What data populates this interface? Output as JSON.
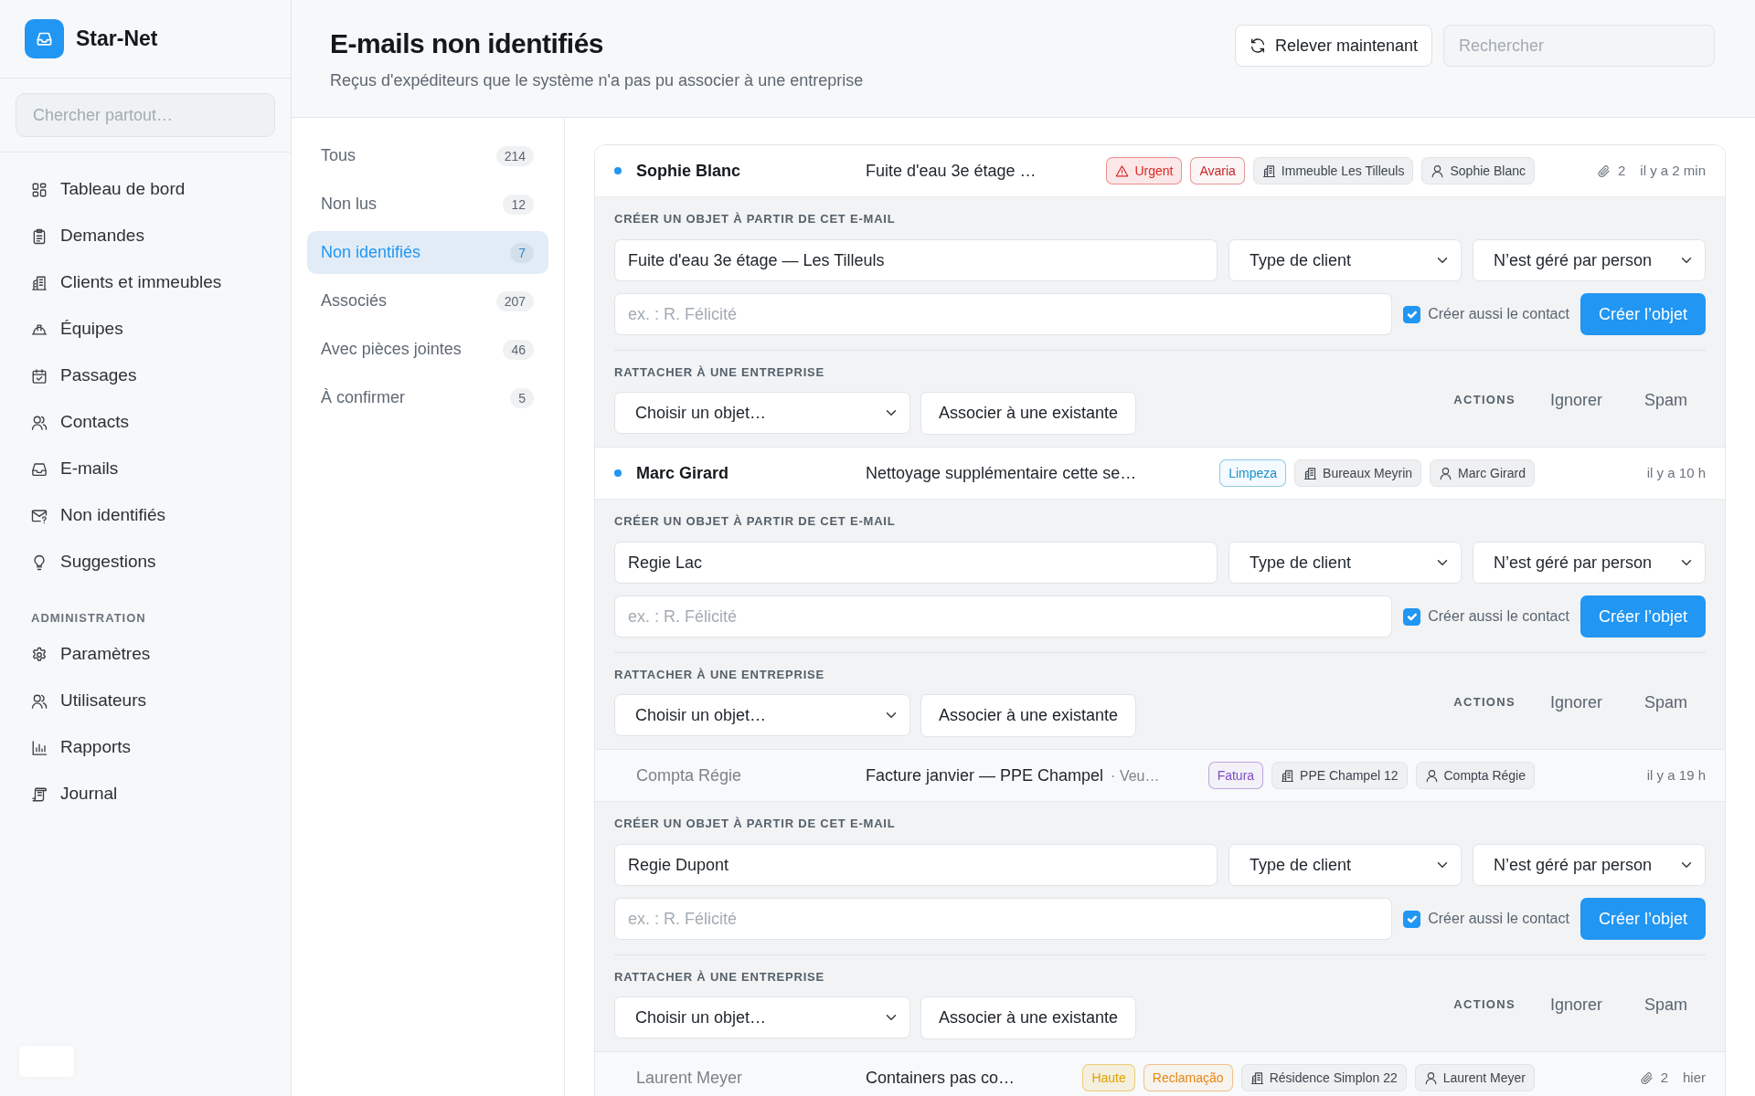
{
  "sidebar": {
    "brand": "Star-Net",
    "search": {
      "placeholder": "Chercher partout…"
    },
    "groups": [
      {
        "items": [
          {
            "label": "Tableau de bord",
            "selected": false
          },
          {
            "label": "Demandes",
            "selected": false
          },
          {
            "label": "Clients et immeubles",
            "selected": false
          },
          {
            "label": "Équipes",
            "selected": false
          },
          {
            "label": "Passages",
            "selected": false
          },
          {
            "label": "Contacts",
            "selected": false
          },
          {
            "label": "E-mails",
            "selected": false
          },
          {
            "label": "Non identifiés",
            "selected": false
          },
          {
            "label": "Suggestions",
            "selected": false
          }
        ]
      },
      {
        "heading": "ADMINISTRATION",
        "items": [
          {
            "label": "Paramètres",
            "selected": false
          },
          {
            "label": "Utilisateurs",
            "selected": false
          },
          {
            "label": "Rapports",
            "selected": false
          },
          {
            "label": "Journal",
            "selected": false
          }
        ]
      }
    ]
  },
  "header": {
    "title": "E-mails non identifiés",
    "subtitle": "Reçus d'expéditeurs que le système n'a pas pu associer à une entreprise",
    "refresh_button": "Relever maintenant",
    "search": {
      "placeholder": "Rechercher"
    }
  },
  "filters": [
    {
      "label": "Tous",
      "count": "214",
      "selected": false
    },
    {
      "label": "Non lus",
      "count": "12",
      "selected": false
    },
    {
      "label": "Non identifiés",
      "count": "7",
      "selected": true
    },
    {
      "label": "Associés",
      "count": "207",
      "selected": false
    },
    {
      "label": "Avec pièces jointes",
      "count": "46",
      "selected": false
    },
    {
      "label": "À confirmer",
      "count": "5",
      "selected": false
    }
  ],
  "emails": [
    {
      "sender": "Sophie Blanc",
      "unread": true,
      "subject": "Fuite d'eau 3e étage …",
      "tags": [
        {
          "kind": "alert",
          "label": "Urgent",
          "color": "#dc2626"
        },
        {
          "kind": "category",
          "label": "Avaria",
          "color": "#c62828"
        },
        {
          "kind": "building",
          "label": "Immeuble Les Tilleuls"
        },
        {
          "kind": "contact",
          "label": "Sophie Blanc"
        }
      ],
      "attachments": "2",
      "time": "il y a 2 min",
      "expanded": true,
      "create_panel": {
        "heading": "CRÉER UN OBJET À PARTIR DE CET E-MAIL",
        "name_value": "Fuite d'eau 3e étage — Les Tilleuls",
        "client_type": "Type de client",
        "manager": "N’est géré par person",
        "contact_placeholder": "ex. : R. Félicité",
        "create_contact": {
          "label": "Créer aussi le contact",
          "checked": true
        },
        "create_button": "Créer l’objet"
      },
      "attach_panel": {
        "heading": "RATTACHER À UNE ENTREPRISE",
        "select": "Choisir un objet…",
        "associate_button": "Associer à une existante",
        "actions_label": "ACTIONS",
        "ignore_button": "Ignorer",
        "spam_button": "Spam"
      }
    },
    {
      "sender": "Marc Girard",
      "unread": true,
      "subject": "Nettoyage supplémentaire cette se…",
      "tags": [
        {
          "kind": "category",
          "label": "Limpeza",
          "color": "#1a8fcc"
        },
        {
          "kind": "building",
          "label": "Bureaux Meyrin"
        },
        {
          "kind": "contact",
          "label": "Marc Girard"
        }
      ],
      "time": "il y a 10 h",
      "expanded": true,
      "create_panel": {
        "heading": "CRÉER UN OBJET À PARTIR DE CET E-MAIL",
        "name_value": "Regie Lac",
        "client_type": "Type de client",
        "manager": "N’est géré par person",
        "contact_placeholder": "ex. : R. Félicité",
        "create_contact": {
          "label": "Créer aussi le contact",
          "checked": true
        },
        "create_button": "Créer l’objet"
      },
      "attach_panel": {
        "heading": "RATTACHER À UNE ENTREPRISE",
        "select": "Choisir un objet…",
        "associate_button": "Associer à une existante",
        "actions_label": "ACTIONS",
        "ignore_button": "Ignorer",
        "spam_button": "Spam"
      }
    },
    {
      "sender": "Compta Régie",
      "unread": false,
      "subject": "Facture janvier — PPE Champel",
      "preview": "· Veu…",
      "tags": [
        {
          "kind": "category",
          "label": "Fatura",
          "color": "#7e4dc8"
        },
        {
          "kind": "building",
          "label": "PPE Champel 12"
        },
        {
          "kind": "contact",
          "label": "Compta Régie"
        }
      ],
      "time": "il y a 19 h",
      "expanded": true,
      "create_panel": {
        "heading": "CRÉER UN OBJET À PARTIR DE CET E-MAIL",
        "name_value": "Regie Dupont",
        "client_type": "Type de client",
        "manager": "N’est géré par person",
        "contact_placeholder": "ex. : R. Félicité",
        "create_contact": {
          "label": "Créer aussi le contact",
          "checked": true
        },
        "create_button": "Créer l’objet"
      },
      "attach_panel": {
        "heading": "RATTACHER À UNE ENTREPRISE",
        "select": "Choisir un objet…",
        "associate_button": "Associer à une existante",
        "actions_label": "ACTIONS",
        "ignore_button": "Ignorer",
        "spam_button": "Spam"
      }
    },
    {
      "sender": "Laurent Meyer",
      "unread": false,
      "subject": "Containers pas co…",
      "tags": [
        {
          "kind": "priority",
          "label": "Haute",
          "color": "#e0a100"
        },
        {
          "kind": "category",
          "label": "Reclamação",
          "color": "#e8870e"
        },
        {
          "kind": "building",
          "label": "Résidence Simplon 22"
        },
        {
          "kind": "contact",
          "label": "Laurent Meyer"
        }
      ],
      "attachments": "2",
      "time": "hier"
    }
  ]
}
